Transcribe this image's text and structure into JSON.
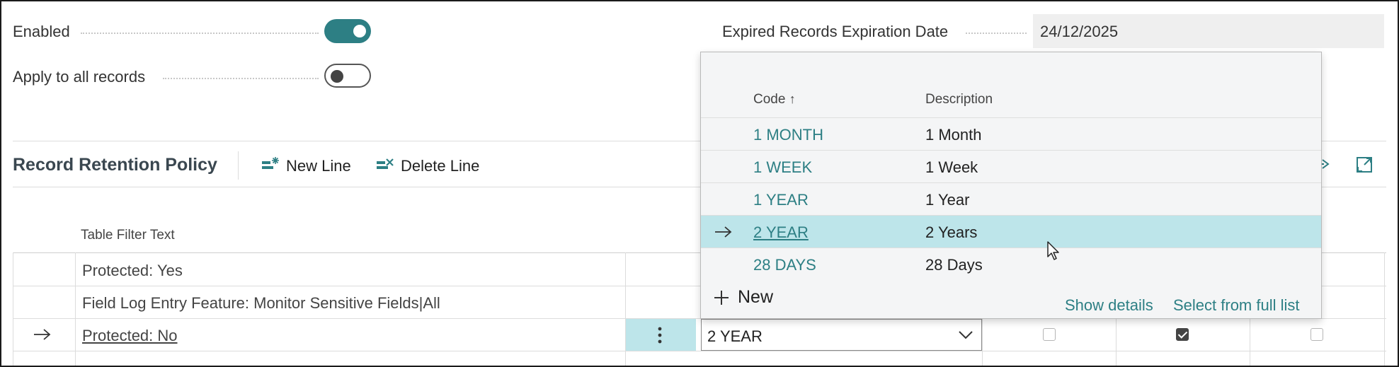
{
  "settings": {
    "enabled_label": "Enabled",
    "apply_label": "Apply to all records",
    "expiration_label": "Expired Records Expiration Date",
    "expiration_value": "24/12/2025"
  },
  "toolbar": {
    "title": "Record Retention Policy",
    "new_line": "New Line",
    "delete_line": "Delete Line"
  },
  "table": {
    "header_filter": "Table Filter Text",
    "rows": [
      {
        "filter": "Protected: Yes"
      },
      {
        "filter": "Field Log Entry Feature: Monitor Sensitive Fields|All"
      },
      {
        "filter": "Protected: No",
        "period": "2 YEAR",
        "checks": [
          false,
          true,
          false
        ]
      }
    ]
  },
  "lookup": {
    "col_code": "Code",
    "col_description": "Description",
    "rows": [
      {
        "code": "1 MONTH",
        "description": "1 Month"
      },
      {
        "code": "1 WEEK",
        "description": "1 Week"
      },
      {
        "code": "1 YEAR",
        "description": "1 Year"
      },
      {
        "code": "2 YEAR",
        "description": "2 Years"
      },
      {
        "code": "28 DAYS",
        "description": "28 Days"
      }
    ],
    "new_label": "New",
    "show_details": "Show details",
    "select_full_list": "Select from full list"
  },
  "icons": {
    "sort": "sort-ascending-icon",
    "row_arrow": "row-pointer-arrow-icon",
    "chevron": "chevron-down-icon"
  },
  "colors": {
    "accent": "#2d7f84",
    "selected_row": "#bde5ea"
  }
}
